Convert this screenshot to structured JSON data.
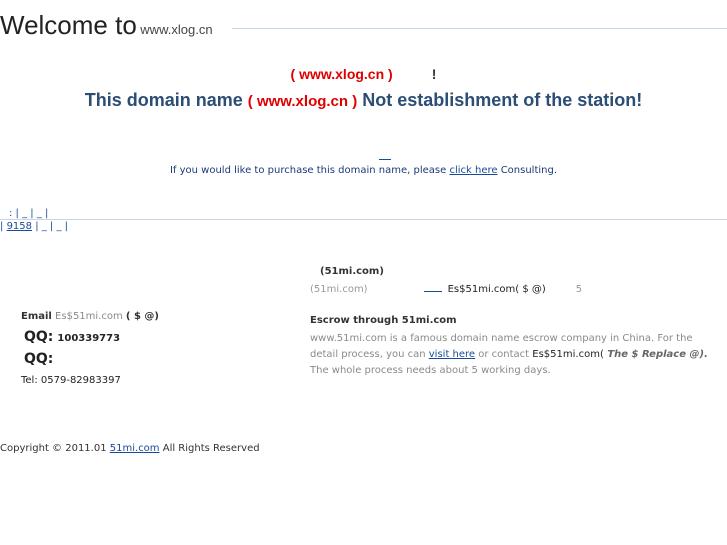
{
  "header": {
    "welcome": "Welcome to",
    "domain": "www.xlog.cn"
  },
  "notice": {
    "red_domain": "( www.xlog.cn )",
    "exclaim": "!",
    "headline_pre": "This domain name ",
    "headline_domain": "( www.xlog.cn )",
    "headline_post": " Not establishment of the station!"
  },
  "purchase": {
    "pre": "If you would like to purchase this domain name, please ",
    "link": "click here",
    "post": " Consulting."
  },
  "links": {
    "row1": ": | _ | _ |",
    "row2_pre": "| ",
    "row2_link": "9158",
    "row2_post": " | _ | _ |"
  },
  "company": {
    "brand": "(51mi.com)",
    "site": "(51mi.com)",
    "email_contact": "Es$51mi.com( $ @)",
    "days": "5"
  },
  "contact": {
    "email_label": "Email",
    "email_value": "Es$51mi.com",
    "email_note": "( $ @)",
    "qq1_label": "QQ:",
    "qq1_value": "100339773",
    "qq2_label": "QQ:",
    "tel": "Tel: 0579-82983397"
  },
  "escrow": {
    "title": "Escrow through 51mi.com",
    "text1": "www.51mi.com is a famous domain name escrow company in China. For the detail process, you can ",
    "visit_link": "visit here",
    "text2": " or contact ",
    "email": "Es$51mi.com(",
    "replace_note": " The $ Replace @).",
    "text3": " The whole process needs about 5 working days."
  },
  "footer": {
    "pre": "Copyright © 2011.01 ",
    "link": "51mi.com",
    "post": " All Rights Reserved"
  }
}
